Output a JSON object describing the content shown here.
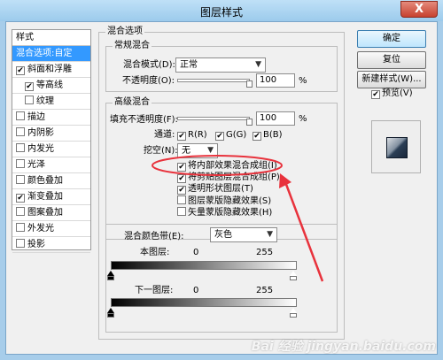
{
  "window": {
    "title": "图层样式",
    "close": "X"
  },
  "list": {
    "header": "样式",
    "items": [
      {
        "label": "混合选项:自定",
        "checked": null,
        "selected": true
      },
      {
        "label": "斜面和浮雕",
        "checked": true
      },
      {
        "label": "等高线",
        "checked": true,
        "indent": true
      },
      {
        "label": "纹理",
        "checked": false,
        "indent": true
      },
      {
        "label": "描边",
        "checked": false
      },
      {
        "label": "内阴影",
        "checked": false
      },
      {
        "label": "内发光",
        "checked": false
      },
      {
        "label": "光泽",
        "checked": false
      },
      {
        "label": "颜色叠加",
        "checked": false
      },
      {
        "label": "渐变叠加",
        "checked": true
      },
      {
        "label": "图案叠加",
        "checked": false
      },
      {
        "label": "外发光",
        "checked": false
      },
      {
        "label": "投影",
        "checked": false
      }
    ]
  },
  "blend": {
    "section_title": "混合选项",
    "general_title": "常规混合",
    "mode_label": "混合模式(D):",
    "mode_value": "正常",
    "opacity_label": "不透明度(O):",
    "opacity_value": "100",
    "opacity_unit": "%",
    "advanced_title": "高级混合",
    "fill_label": "填充不透明度(F):",
    "fill_value": "100",
    "fill_unit": "%",
    "channels_label": "通道:",
    "ch_r": "R(R)",
    "ch_g": "G(G)",
    "ch_b": "B(B)",
    "knockout_label": "挖空(N):",
    "knockout_value": "无",
    "options": [
      {
        "label": "将内部效果混合成组(I)",
        "checked": true
      },
      {
        "label": "将剪贴图层混合成组(P)",
        "checked": true
      },
      {
        "label": "透明形状图层(T)",
        "checked": true
      },
      {
        "label": "图层蒙版隐藏效果(S)",
        "checked": false
      },
      {
        "label": "矢量蒙版隐藏效果(H)",
        "checked": false
      }
    ],
    "blendif_label": "混合颜色带(E):",
    "blendif_value": "灰色",
    "this_layer": "本图层:",
    "this_min": "0",
    "this_max": "255",
    "underlying": "下一图层:",
    "under_min": "0",
    "under_max": "255"
  },
  "buttons": {
    "ok": "确定",
    "reset": "复位",
    "new_style": "新建样式(W)...",
    "preview": "预览(V)"
  },
  "checkmark": "✔",
  "watermark": "Bai 经验 jingyan.baidu.com",
  "annotation_color": "#e8323c"
}
